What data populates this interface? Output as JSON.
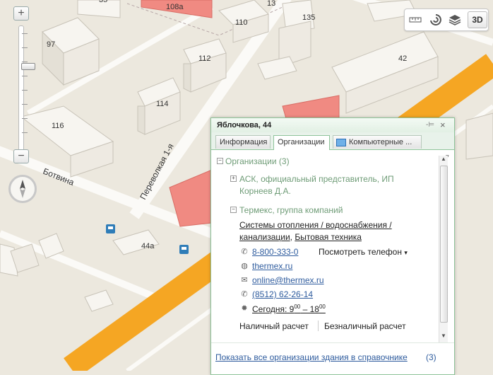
{
  "map": {
    "building_labels": [
      "108а",
      "97",
      "110",
      "135",
      "112",
      "42",
      "114",
      "116",
      "44а",
      "35",
      "13"
    ],
    "street_labels": [
      "Ботвина",
      "Переволкая 1-я"
    ],
    "colors": {
      "background": "#ece8de",
      "road": "#fbfaf7",
      "major_road": "#f5a623",
      "highlight": "#f08a82",
      "bus_stop": "#2f7db8"
    }
  },
  "zoom": {
    "plus": "+",
    "minus": "−"
  },
  "toolbar": {
    "btn_3d": "3D",
    "icons": [
      "ruler-icon",
      "panorama-icon",
      "layers-icon"
    ]
  },
  "popup": {
    "title": "Яблочкова, 44",
    "tabs": [
      {
        "label": "Информация"
      },
      {
        "label": "Организации"
      },
      {
        "label": "Компьютерные ..."
      }
    ],
    "active_tab": "Организации",
    "section_header": "Организации (3)",
    "org1": {
      "line1": "АСК, официальный представитель, ИП",
      "line2": "Корнеев Д.А."
    },
    "org2": {
      "name": "Термекс, группа компаний",
      "cat_line1": "Системы отопления / водоснабжения /",
      "cat_line2a": "канализации",
      "cat_sep": ", ",
      "cat_line2b": "Бытовая техника",
      "phone1": "8-800-333-0",
      "show_phone": "Посмотреть телефон",
      "website": "thermex.ru",
      "email": "online@thermex.ru",
      "phone2": "(8512) 62-26-14",
      "hours_prefix": "Сегодня: 9",
      "hours_from_sup": "00",
      "hours_dash": " – 18",
      "hours_to_sup": "00",
      "pay_cash": "Наличный расчет",
      "pay_card": "Безналичный расчет"
    },
    "footer_link": "Показать все организации здания в справочнике",
    "footer_count": "(3)"
  }
}
